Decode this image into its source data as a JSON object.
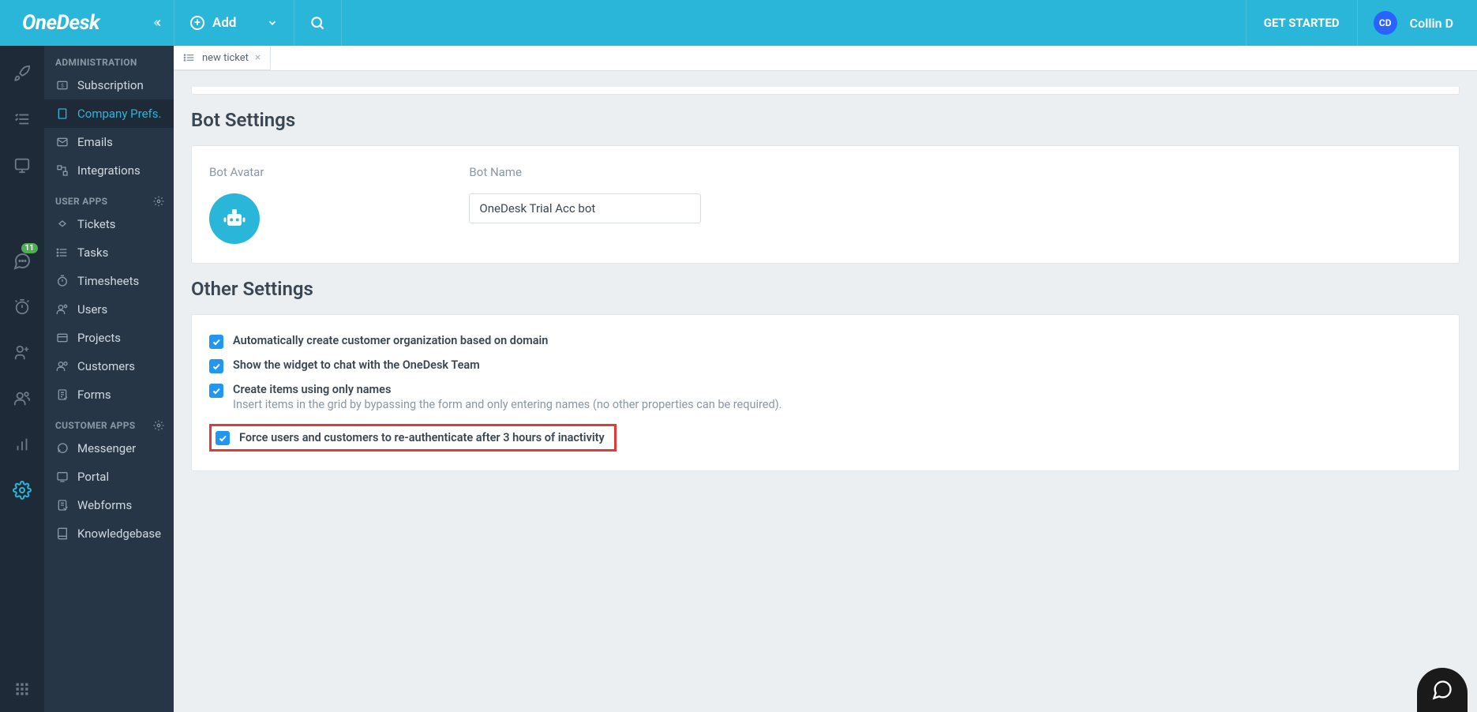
{
  "header": {
    "logo_text": "OneDesk",
    "add_label": "Add",
    "get_started": "GET STARTED",
    "user_initials": "CD",
    "username": "Collin D"
  },
  "rail": {
    "badge_count": "11"
  },
  "sidebar": {
    "section_admin": "ADMINISTRATION",
    "subscription": "Subscription",
    "company_prefs": "Company Prefs.",
    "emails": "Emails",
    "integrations": "Integrations",
    "section_user_apps": "USER APPS",
    "tickets": "Tickets",
    "tasks": "Tasks",
    "timesheets": "Timesheets",
    "users": "Users",
    "projects": "Projects",
    "customers": "Customers",
    "forms": "Forms",
    "section_customer_apps": "CUSTOMER APPS",
    "messenger": "Messenger",
    "portal": "Portal",
    "webforms": "Webforms",
    "knowledgebase": "Knowledgebase"
  },
  "tab": {
    "label": "new ticket"
  },
  "bot_settings": {
    "title": "Bot Settings",
    "avatar_label": "Bot Avatar",
    "name_label": "Bot Name",
    "name_value": "OneDesk Trial Acc bot"
  },
  "other_settings": {
    "title": "Other Settings",
    "opt1": "Automatically create customer organization based on domain",
    "opt2": "Show the widget to chat with the OneDesk Team",
    "opt3": "Create items using only names",
    "opt3_sub": "Insert items in the grid by bypassing the form and only entering names (no other properties can be required).",
    "opt4": "Force users and customers to re-authenticate after 3 hours of inactivity"
  }
}
